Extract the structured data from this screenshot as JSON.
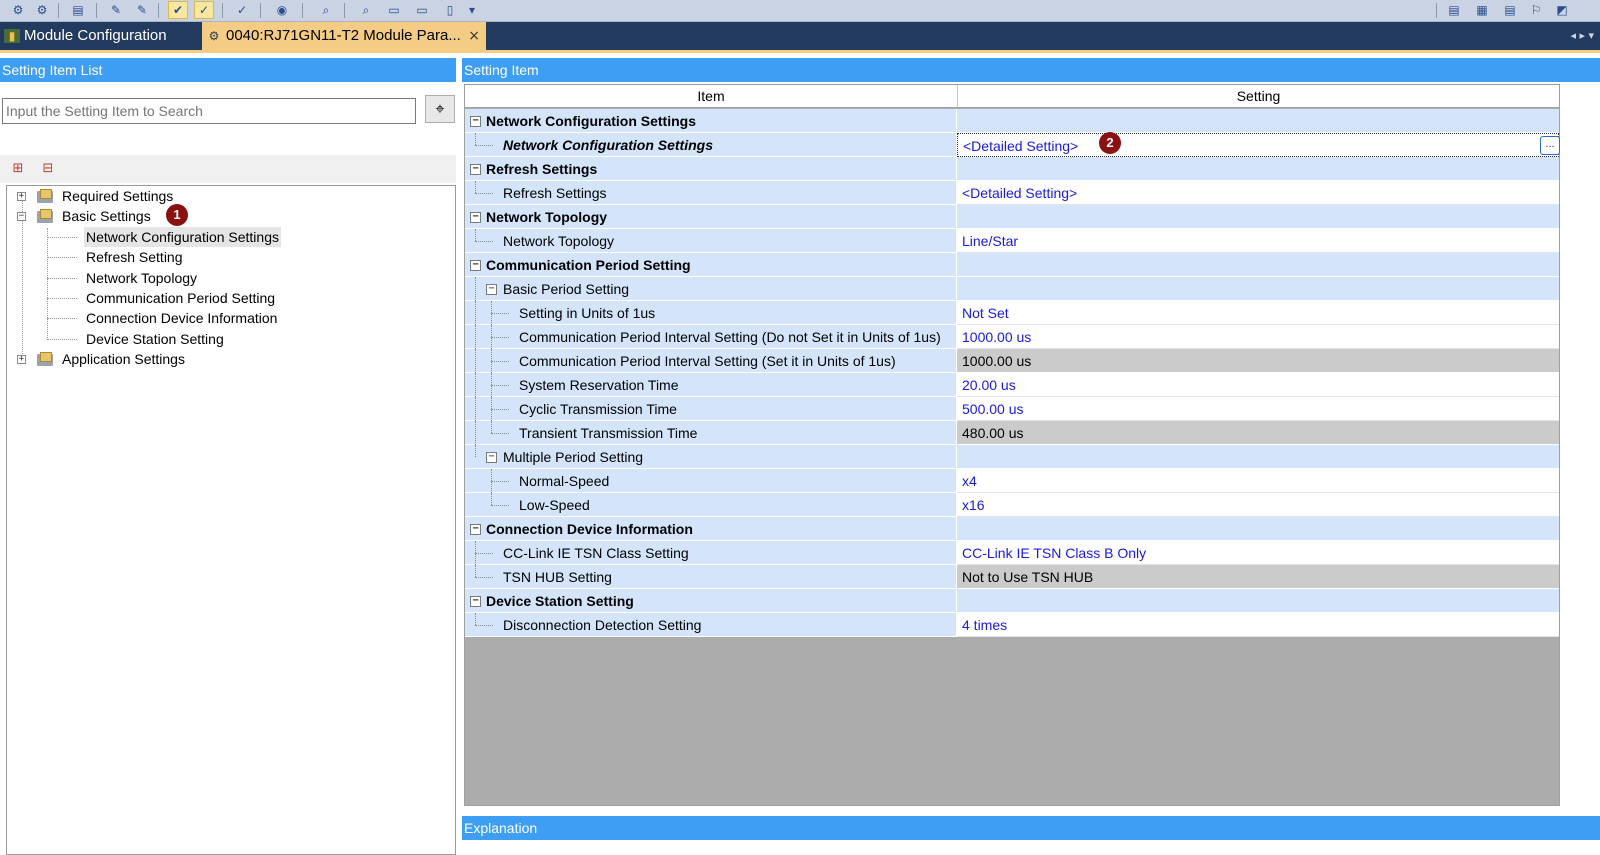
{
  "toolbar": {
    "icons": [
      "module-icon",
      "module-view-icon",
      "list-icon",
      "edit-icon",
      "edit-alt-icon",
      "check-icon",
      "check-alt-icon",
      "verify-icon",
      "watch-icon",
      "search-icon",
      "find-icon",
      "zoom-icon",
      "print-icon",
      "scan-icon",
      "export-icon",
      "layout-icon",
      "window-icon",
      "grid-icon",
      "arrange-icon",
      "tile-icon"
    ]
  },
  "tabs": {
    "module_config": "Module Configuration",
    "module_param": "0040:RJ71GN11-T2 Module Para...",
    "close": "×",
    "nav": "◂ ▸ ▾"
  },
  "left_pane": {
    "header": "Setting Item List",
    "search_placeholder": "Input the Setting Item to Search",
    "search_button_icon": "binoculars-icon",
    "tree": {
      "required": "Required Settings",
      "basic": "Basic Settings",
      "basic_children": [
        "Network Configuration Settings",
        "Refresh Setting",
        "Network Topology",
        "Communication Period Setting",
        "Connection Device Information",
        "Device Station Setting"
      ],
      "application": "Application Settings"
    }
  },
  "badges": {
    "one": "1",
    "two": "2"
  },
  "right_pane": {
    "header": "Setting Item",
    "col_item": "Item",
    "col_setting": "Setting",
    "rows": [
      {
        "item": "Network Configuration Settings",
        "setting": ""
      },
      {
        "item": "Network Configuration Settings",
        "setting": "<Detailed Setting>"
      },
      {
        "item": "Refresh Settings",
        "setting": ""
      },
      {
        "item": "Refresh Settings",
        "setting": "<Detailed Setting>"
      },
      {
        "item": "Network Topology",
        "setting": ""
      },
      {
        "item": "Network Topology",
        "setting": "Line/Star"
      },
      {
        "item": "Communication Period Setting",
        "setting": ""
      },
      {
        "item": "Basic Period Setting",
        "setting": ""
      },
      {
        "item": "Setting in Units of 1us",
        "setting": "Not Set"
      },
      {
        "item": "Communication Period Interval Setting (Do not Set it in Units of 1us)",
        "setting": "1000.00 us"
      },
      {
        "item": "Communication Period Interval Setting (Set it in Units of 1us)",
        "setting": "1000.00 us"
      },
      {
        "item": "System Reservation Time",
        "setting": "20.00 us"
      },
      {
        "item": "Cyclic Transmission Time",
        "setting": "500.00 us"
      },
      {
        "item": "Transient Transmission Time",
        "setting": "480.00 us"
      },
      {
        "item": "Multiple Period Setting",
        "setting": ""
      },
      {
        "item": "Normal-Speed",
        "setting": "x4"
      },
      {
        "item": "Low-Speed",
        "setting": "x16"
      },
      {
        "item": "Connection Device Information",
        "setting": ""
      },
      {
        "item": "CC-Link IE TSN Class Setting",
        "setting": "CC-Link IE TSN Class B Only"
      },
      {
        "item": "TSN HUB Setting",
        "setting": "Not to Use TSN HUB"
      },
      {
        "item": "Device Station Setting",
        "setting": ""
      },
      {
        "item": "Disconnection Detection Setting",
        "setting": "4 times"
      }
    ],
    "ellipsis": "..."
  },
  "explanation": {
    "header": "Explanation"
  },
  "colors": {
    "header_blue": "#3d9ef3",
    "tab_bar": "#223a5e",
    "active_tab": "#f5cc84",
    "item_cell": "#d3e4fb",
    "value_text": "#1a1ae0",
    "readonly_cell": "#cbcbcb",
    "badge": "#8b1111"
  }
}
